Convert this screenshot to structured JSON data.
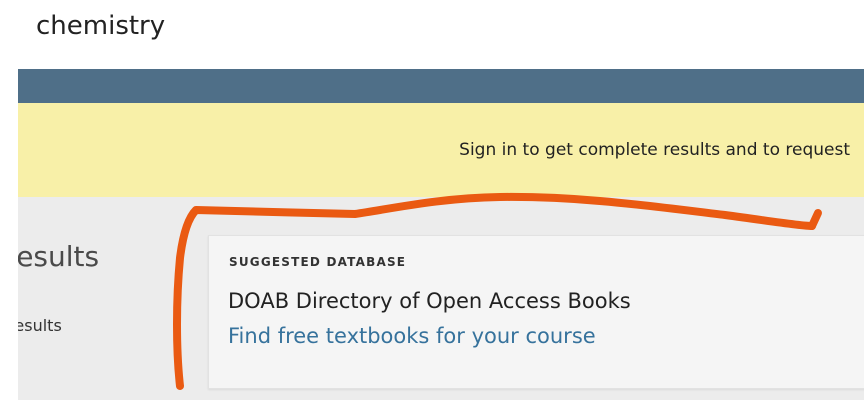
{
  "search": {
    "term": "chemistry"
  },
  "banner": {
    "text": "Sign in to get complete results and to request"
  },
  "results": {
    "heading": "Results",
    "subtext": "Results"
  },
  "suggested_card": {
    "tag": "SUGGESTED DATABASE",
    "title": "DOAB Directory of Open Access Books",
    "link_text": "Find free textbooks for your course"
  },
  "colors": {
    "topbar": "#4f6f88",
    "banner": "#f8f0a8",
    "link": "#36729c",
    "annotation": "#ea5a12"
  }
}
